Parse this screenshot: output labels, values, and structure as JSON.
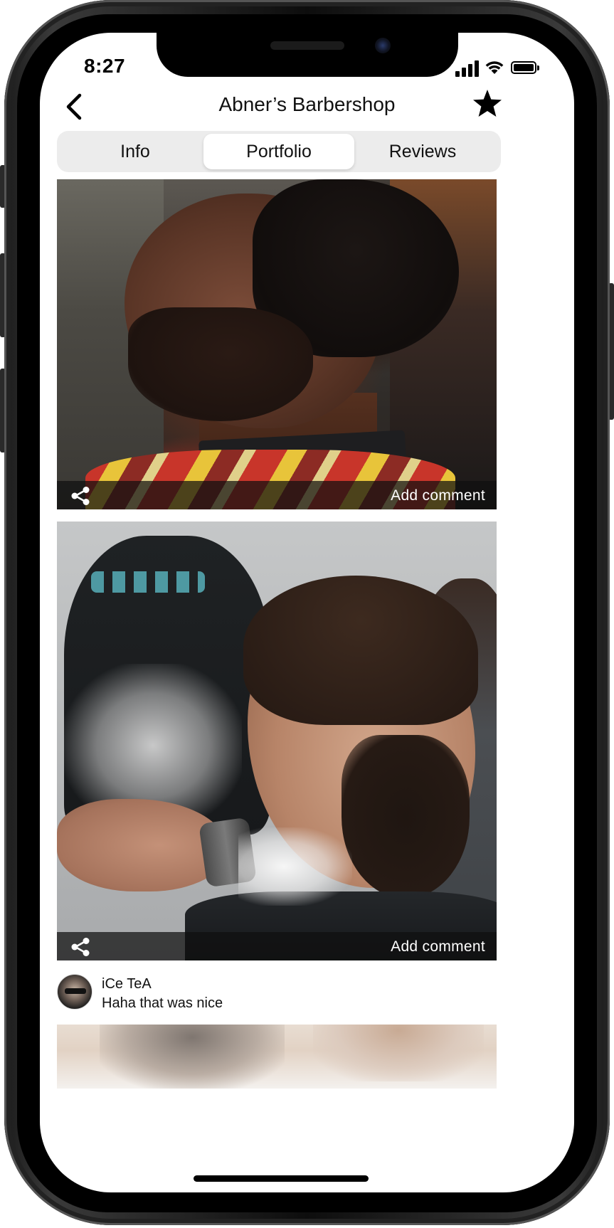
{
  "status_bar": {
    "time": "8:27",
    "signal_icon": "cellular-signal-icon",
    "wifi_icon": "wifi-icon",
    "battery_icon": "battery-full-icon"
  },
  "nav": {
    "back_icon": "chevron-left-icon",
    "title": "Abner’s Barbershop",
    "favorite_icon": "star-filled-icon"
  },
  "tabs": [
    {
      "label": "Info",
      "active": false
    },
    {
      "label": "Portfolio",
      "active": true
    },
    {
      "label": "Reviews",
      "active": false
    }
  ],
  "portfolio": {
    "items": [
      {
        "share_icon": "share-icon",
        "action_label": "Add comment"
      },
      {
        "share_icon": "share-icon",
        "action_label": "Add comment"
      }
    ]
  },
  "comment": {
    "username": "iCe TeA",
    "text": "Haha that was nice",
    "avatar": "user-avatar"
  },
  "colors": {
    "accent": "#000000",
    "segment_bg": "#ececec",
    "card_bar": "#0f0f0f"
  }
}
